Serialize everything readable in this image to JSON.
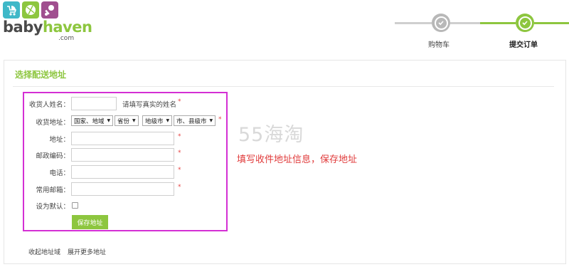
{
  "brand": {
    "name_part1": "baby",
    "name_part2": "haven",
    "domain": ".com",
    "colors": {
      "green": "#8dc63f",
      "gray": "#4a4a4a",
      "teal": "#3fb8c8",
      "pink": "#a04f8f"
    }
  },
  "steps": [
    {
      "label": "购物车",
      "state": "done"
    },
    {
      "label": "提交订单",
      "state": "current"
    }
  ],
  "panel": {
    "title": "选择配送地址"
  },
  "form": {
    "name_label": "收货人姓名：",
    "name_hint": "请填写真实的姓名",
    "region_label": "收货地址：",
    "region_selects": [
      "国家、地域",
      "省份",
      "地级市",
      "市、县级市"
    ],
    "address_label": "地址：",
    "postcode_label": "邮政编码：",
    "phone_label": "电话：",
    "email_label": "常用邮箱：",
    "default_label": "设为默认：",
    "required_mark": "*",
    "save_button": "保存地址"
  },
  "links": {
    "collapse": "收起地址域",
    "expand": "展开更多地址"
  },
  "watermark": "55海淘",
  "annotation": "填写收件地址信息，保存地址"
}
